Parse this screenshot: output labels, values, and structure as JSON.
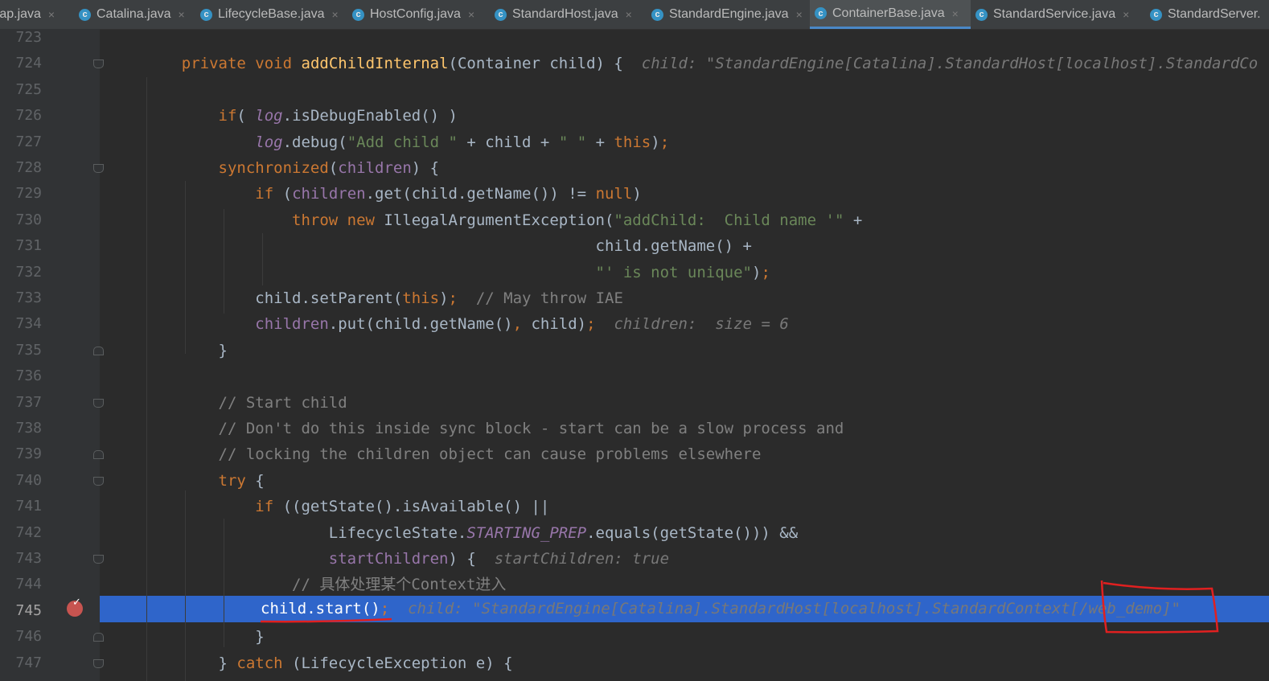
{
  "tabs": [
    {
      "label": "rap.java",
      "close": "×",
      "active": false,
      "icon": "class-icon",
      "icon_glyph": "c"
    },
    {
      "label": "Catalina.java",
      "close": "×",
      "active": false,
      "icon": "class-icon",
      "icon_glyph": "c"
    },
    {
      "label": "LifecycleBase.java",
      "close": "×",
      "active": false,
      "icon": "abstract-class-icon",
      "icon_glyph": "c"
    },
    {
      "label": "HostConfig.java",
      "close": "×",
      "active": false,
      "icon": "class-icon",
      "icon_glyph": "c"
    },
    {
      "label": "StandardHost.java",
      "close": "×",
      "active": false,
      "icon": "class-icon",
      "icon_glyph": "c"
    },
    {
      "label": "StandardEngine.java",
      "close": "×",
      "active": false,
      "icon": "class-icon",
      "icon_glyph": "c"
    },
    {
      "label": "ContainerBase.java",
      "close": "×",
      "active": true,
      "icon": "abstract-class-icon",
      "icon_glyph": "c"
    },
    {
      "label": "StandardService.java",
      "close": "×",
      "active": false,
      "icon": "class-icon",
      "icon_glyph": "c"
    },
    {
      "label": "StandardServer.",
      "close": "",
      "active": false,
      "icon": "class-icon",
      "icon_glyph": "c"
    }
  ],
  "editor": {
    "line_numbers": [
      "723",
      "724",
      "725",
      "726",
      "727",
      "728",
      "729",
      "730",
      "731",
      "732",
      "733",
      "734",
      "735",
      "736",
      "737",
      "738",
      "739",
      "740",
      "741",
      "742",
      "743",
      "744",
      "745",
      "746",
      "747"
    ],
    "current_line": "745",
    "breakpoint_line": "745",
    "hints": {
      "l724": "child: \"StandardEngine[Catalina].StandardHost[localhost].StandardCo",
      "l734": "children:  size = 6",
      "l743": "startChildren: true",
      "l745": "child: \"StandardEngine[Catalina].StandardHost[localhost].StandardContext[/web_demo]\""
    },
    "comments": {
      "l733": "// May throw IAE",
      "l737": "// Start child",
      "l738": "// Don't do this inside sync block - start can be a slow process and",
      "l739": "// locking the children object can cause problems elsewhere",
      "l744": "// 具体处理某个Context进入"
    },
    "strings": {
      "l727a": "\"Add child \"",
      "l727b": "\" \"",
      "l730": "\"addChild:  Child name '\"",
      "l732": "\"' is not unique\""
    }
  },
  "colors": {
    "background": "#2b2b2b",
    "gutter": "#313335",
    "current_line": "#2f65ca",
    "keyword": "#cc7832",
    "method": "#ffc66d",
    "string": "#6a8759",
    "comment": "#808080",
    "field": "#9876aa",
    "annotation_ink": "#e02020"
  }
}
